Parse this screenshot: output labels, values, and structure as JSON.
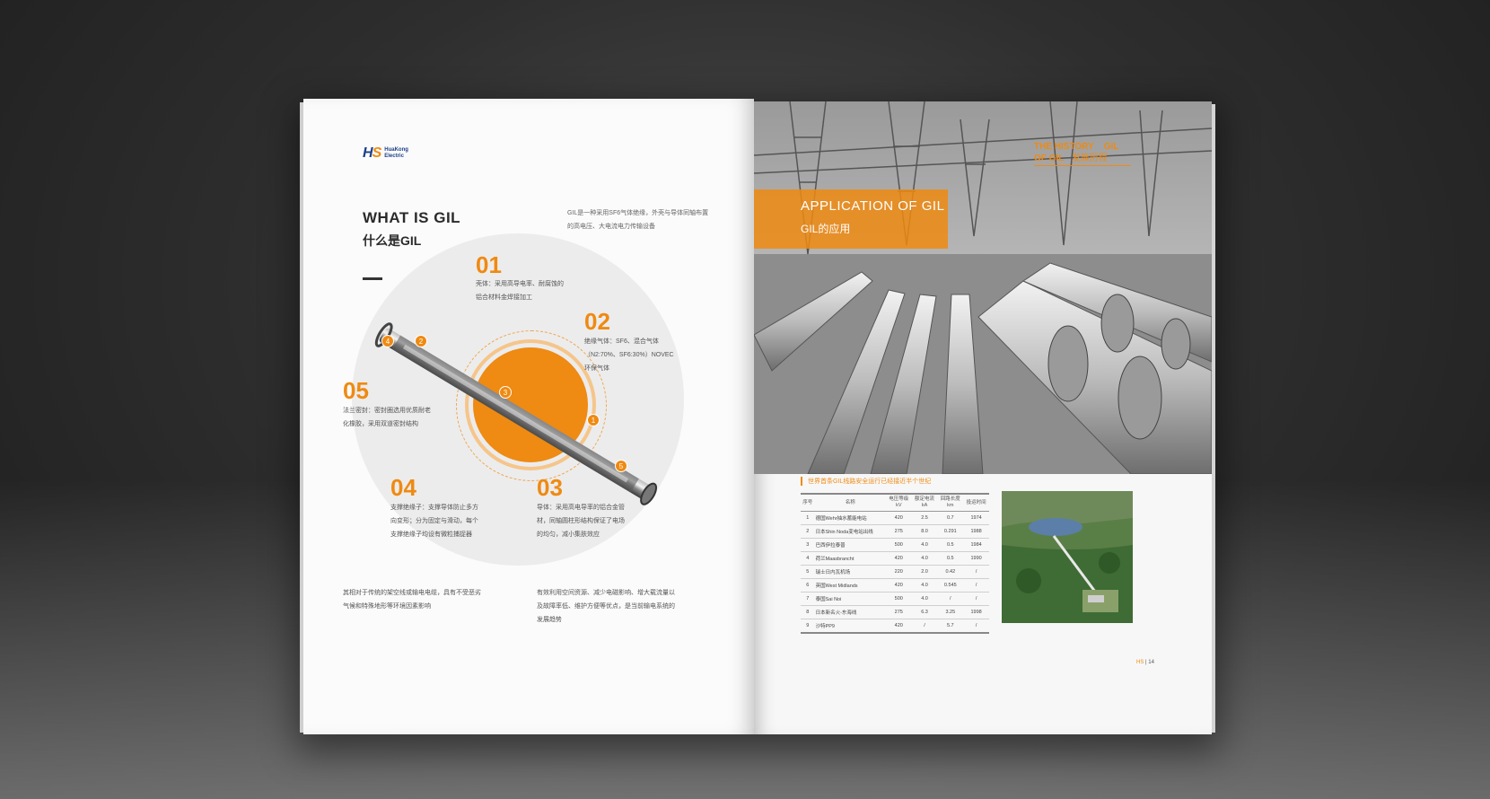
{
  "left_page": {
    "logo": {
      "mark_h": "H",
      "mark_s": "S",
      "name_line1": "HuaKong",
      "name_line2": "Electric"
    },
    "heading_en": "WHAT IS GIL",
    "heading_cn": "什么是GIL",
    "intro": "GIL是一种采用SF6气体绝缘，外壳与导体同轴布置的高电压、大电流电力传输设备",
    "parts": [
      {
        "num": "01",
        "desc": "壳体：采用高导电率、耐腐蚀的铝合材料金焊接加工"
      },
      {
        "num": "02",
        "desc": "绝缘气体：SF6、混合气体（N2:70%、SF6:30%）NOVEC环保气体"
      },
      {
        "num": "03",
        "desc": "导体：采用高电导率的铝合金管材，同轴圆柱形结构保证了电场的均匀，减小集肤效应"
      },
      {
        "num": "04",
        "desc": "支撑绝缘子：支撑导体防止多方向变形；分为固定与滑动，每个支撑绝缘子均设有微粒捕捉器"
      },
      {
        "num": "05",
        "desc": "法兰密封：密封圈选用优质耐老化橡胶，采用双道密封结构"
      }
    ],
    "markers": [
      "1",
      "2",
      "3",
      "4",
      "5"
    ],
    "bottom_left": "其相对于传统的架空线或输电电缆，具有不受恶劣气候和特殊地形等环境因素影响",
    "bottom_right": "有效利用空间资源、减少电磁影响、增大载流量以及故障率低、维护方便等优点，是当前输电系统的发展趋势"
  },
  "right_page": {
    "history_en_1": "THE HISTORY",
    "history_en_2": "OF GIL",
    "history_gil": "GIL",
    "history_cn": "发展历程",
    "application_en": "APPLICATION OF GIL",
    "application_cn": "GIL的应用",
    "table_title": "世界首条GIL线路安全运行已经接近半个世纪",
    "table_headers": [
      [
        "序号",
        ""
      ],
      [
        "名称",
        ""
      ],
      [
        "电压等级",
        "kV"
      ],
      [
        "额定电流",
        "kA"
      ],
      [
        "回路长度",
        "km"
      ],
      [
        "投运时间",
        ""
      ]
    ],
    "table_rows": [
      [
        "1",
        "德国Wehr抽水蓄能电站",
        "420",
        "2.5",
        "0.7",
        "1974"
      ],
      [
        "2",
        "日本Shin Noda变电站出线",
        "275",
        "8.0",
        "0.291",
        "1988"
      ],
      [
        "3",
        "巴西伊拉泰普",
        "500",
        "4.0",
        "0.5",
        "1984"
      ],
      [
        "4",
        "荷兰Maasbrancht",
        "420",
        "4.0",
        "0.5",
        "1990"
      ],
      [
        "5",
        "瑞士日内瓦机场",
        "220",
        "2.0",
        "0.42",
        "/"
      ],
      [
        "6",
        "英国West Midlands",
        "420",
        "4.0",
        "0.545",
        "/"
      ],
      [
        "7",
        "泰国Sai Noi",
        "500",
        "4.0",
        "/",
        "/"
      ],
      [
        "8",
        "日本新名火-东海线",
        "275",
        "6.3",
        "3.25",
        "1998"
      ],
      [
        "9",
        "沙特PP9",
        "420",
        "/",
        "5.7",
        "/"
      ]
    ],
    "page_number": "14",
    "page_logo": "HS"
  },
  "colors": {
    "accent": "#ef8a12",
    "brand_blue": "#1c3f8a"
  }
}
